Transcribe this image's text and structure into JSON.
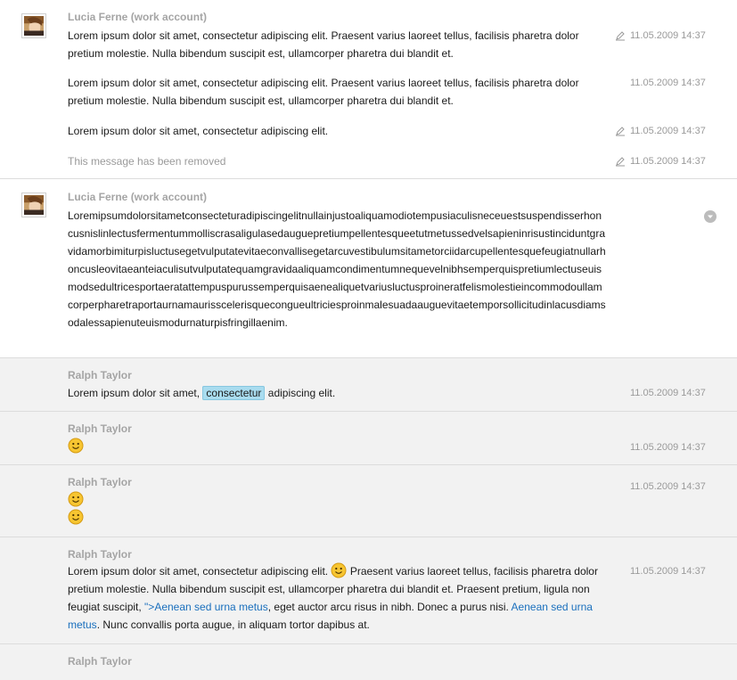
{
  "conversation": {
    "groups": [
      {
        "sender": "Lucia Ferne (work account)",
        "messages": [
          {
            "text": "Lorem ipsum dolor sit amet, consectetur adipiscing elit. Praesent varius laoreet tellus, facilisis pharetra dolor pretium molestie. Nulla bibendum suscipit est, ullamcorper pharetra dui blandit et.",
            "time": "11.05.2009 14:37",
            "edited": true
          },
          {
            "text": "Lorem ipsum dolor sit amet, consectetur adipiscing elit. Praesent varius laoreet tellus, facilisis pharetra dolor pretium molestie. Nulla bibendum suscipit est, ullamcorper pharetra dui blandit et.",
            "time": "11.05.2009 14:37",
            "edited": false
          },
          {
            "text": "Lorem ipsum dolor sit amet, consectetur adipiscing elit.",
            "time": "11.05.2009 14:37",
            "edited": true
          },
          {
            "text": "This message has been removed",
            "time": "11.05.2009 14:37",
            "edited": true,
            "removed": true
          }
        ]
      },
      {
        "sender": "Lucia Ferne (work account)",
        "messages": [
          {
            "text": "Loremipsumdolorsitametconsecteturadipiscingelitnullainjustoaliquamodiotempusiaculisneceuestsuspendisserhoncusnislinlectusfermentummolliscrasaligulasedauguepretiumpellentesqueetutmetussedvelsapieninrisustinciduntgravidamorbimiturpisluctusegetvulputatevitaeconvallisegetarcuvestibulumsitametorciidarcupellentesquefeugiatnullarhoncusleovitaeanteiaculisutvulputatequamgravidaaliquamcondimentumnequevelnibhsemperquispretiumlectuseuismodsedultricesportaeratattempuspurussemperquisaenealiquetvariusluctusproineratfelismolestieincommodoullamcorperpharetraportaurnamaurisscelerisquecongueultriciesproinmalesuadaauguevitaetemporsollicitudinlacusdiamsodalessapienuteuismodurnaturpisfringillaenim."
          }
        ]
      },
      {
        "sender": "Ralph Taylor",
        "messages": [
          {
            "text_before": "Lorem ipsum dolor sit amet, ",
            "highlight": "consectetur",
            "text_after": " adipiscing elit.",
            "time": "11.05.2009 14:37"
          }
        ]
      },
      {
        "sender": "Ralph Taylor",
        "messages": [
          {
            "emoticon": "smiley-icon",
            "time": "11.05.2009 14:37"
          }
        ]
      },
      {
        "sender": "Ralph Taylor",
        "messages": [
          {
            "emoticon": "smiley-icon",
            "emoticon_count": 2,
            "time": "11.05.2009 14:37"
          }
        ]
      },
      {
        "sender": "Ralph Taylor",
        "messages": [
          {
            "part1": "Lorem ipsum dolor sit amet, consectetur adipiscing elit.",
            "part2": " Praesent varius laoreet tellus, facilisis pharetra dolor pretium molestie. Nulla bibendum suscipit est, ullamcorper pharetra dui blandit et. Praesent pretium, ligula non feugiat suscipit, ",
            "link1": "\">Aenean sed urna metus",
            "part3": ", eget auctor arcu risus in nibh. Donec a purus nisi. ",
            "link2": "Aenean sed urna metus",
            "part4": ". Nunc convallis porta augue, in aliquam tortor dapibus at.",
            "time": "11.05.2009 14:37"
          }
        ]
      },
      {
        "sender": "Ralph Taylor"
      }
    ]
  },
  "colors": {
    "gray_bg": "#f2f2f2",
    "sender": "#a5a5a5",
    "link": "#1a6fbd",
    "highlight": "#a9dcef"
  }
}
